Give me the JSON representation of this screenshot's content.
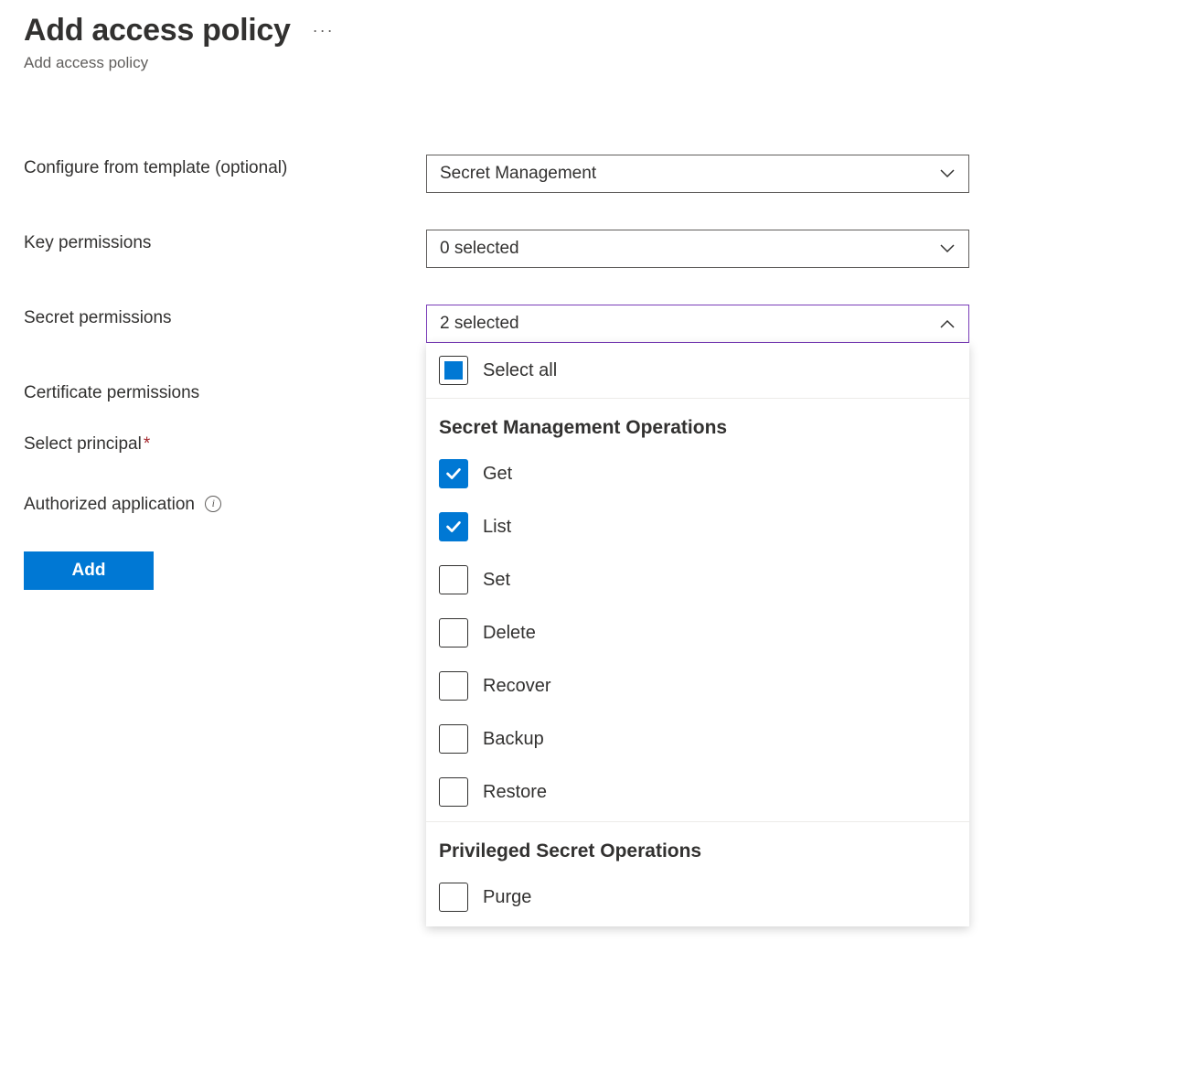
{
  "header": {
    "title": "Add access policy",
    "subtitle": "Add access policy"
  },
  "form": {
    "configure_template": {
      "label": "Configure from template (optional)",
      "value": "Secret Management"
    },
    "key_permissions": {
      "label": "Key permissions",
      "value": "0 selected"
    },
    "secret_permissions": {
      "label": "Secret permissions",
      "value": "2 selected",
      "select_all_label": "Select all",
      "groups": [
        {
          "heading": "Secret Management Operations",
          "options": [
            {
              "label": "Get",
              "checked": true
            },
            {
              "label": "List",
              "checked": true
            },
            {
              "label": "Set",
              "checked": false
            },
            {
              "label": "Delete",
              "checked": false
            },
            {
              "label": "Recover",
              "checked": false
            },
            {
              "label": "Backup",
              "checked": false
            },
            {
              "label": "Restore",
              "checked": false
            }
          ]
        },
        {
          "heading": "Privileged Secret Operations",
          "options": [
            {
              "label": "Purge",
              "checked": false
            }
          ]
        }
      ]
    },
    "certificate_permissions": {
      "label": "Certificate permissions"
    },
    "select_principal": {
      "label": "Select principal"
    },
    "authorized_application": {
      "label": "Authorized application"
    },
    "add_button": "Add"
  }
}
